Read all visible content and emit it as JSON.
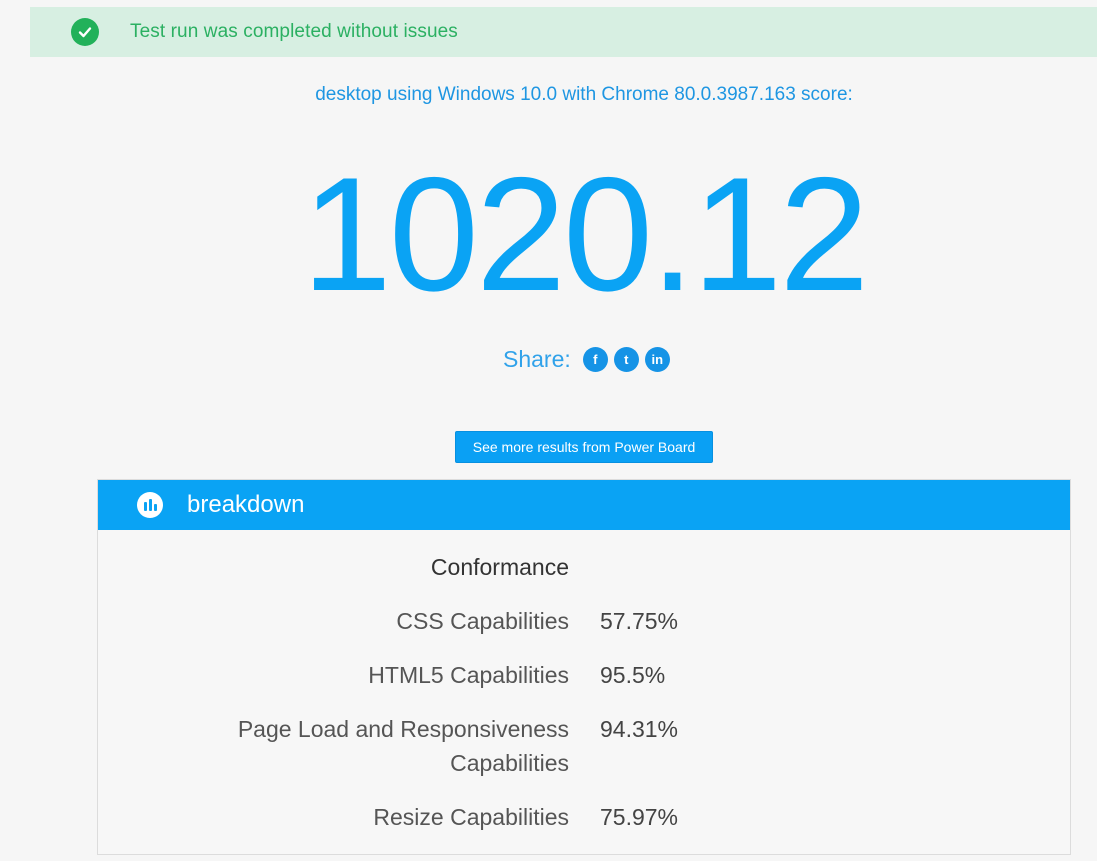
{
  "alert": {
    "message": "Test run was completed without issues",
    "icon": "check-circle-icon",
    "color": "#22b15a"
  },
  "summary": {
    "subtitle": "desktop using Windows 10.0 with Chrome 80.0.3987.163 score:",
    "score": "1020.12"
  },
  "share": {
    "label": "Share:",
    "facebook": "f",
    "twitter": "t",
    "linkedin": "in"
  },
  "more_button": {
    "label": "See more results from Power Board"
  },
  "breakdown": {
    "title": "breakdown",
    "icon": "bar-chart-icon",
    "heading": "Conformance",
    "rows": [
      {
        "label": "CSS Capabilities",
        "value": "57.75%"
      },
      {
        "label": "HTML5 Capabilities",
        "value": "95.5%"
      },
      {
        "label": "Page Load and Responsiveness Capabilities",
        "value": "94.31%"
      },
      {
        "label": "Resize Capabilities",
        "value": "75.97%"
      }
    ]
  },
  "colors": {
    "accent": "#0aa3f4",
    "alert_bg": "#d7efe2",
    "alert_text": "#2bb062"
  }
}
